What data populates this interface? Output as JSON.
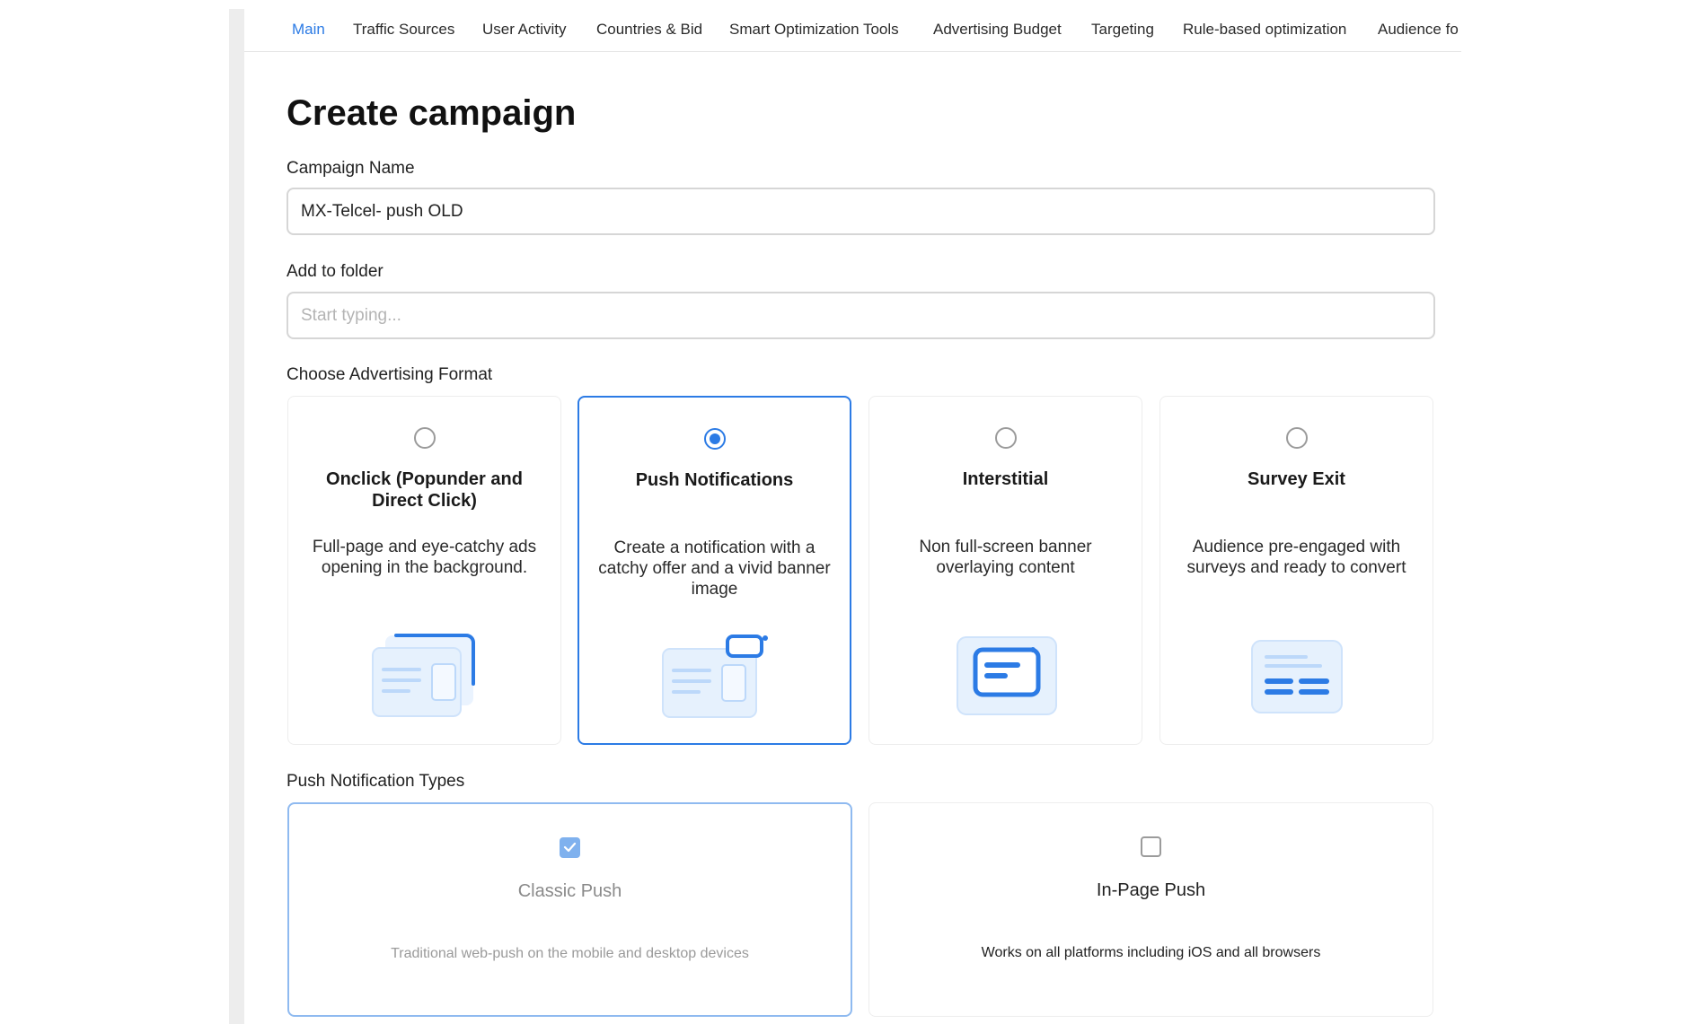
{
  "tabs": [
    {
      "label": "Main",
      "active": true
    },
    {
      "label": "Traffic Sources"
    },
    {
      "label": "User Activity"
    },
    {
      "label": "Countries & Bid"
    },
    {
      "label": "Smart Optimization Tools"
    },
    {
      "label": "Advertising Budget"
    },
    {
      "label": "Targeting"
    },
    {
      "label": "Rule-based optimization"
    },
    {
      "label": "Audience fo"
    }
  ],
  "page_title": "Create campaign",
  "campaign_name": {
    "label": "Campaign Name",
    "value": "MX-Telcel- push OLD"
  },
  "folder": {
    "label": "Add to folder",
    "placeholder": "Start typing..."
  },
  "ad_format": {
    "label": "Choose Advertising Format",
    "options": [
      {
        "title": "Onclick (Popunder and Direct Click)",
        "description": "Full-page and eye-catchy ads opening in the background.",
        "selected": false,
        "icon": "popunder-window-icon"
      },
      {
        "title": "Push Notifications",
        "description": "Create a notification with a catchy offer and a vivid banner image",
        "selected": true,
        "icon": "push-notification-icon"
      },
      {
        "title": "Interstitial",
        "description": "Non full-screen banner overlaying content",
        "selected": false,
        "icon": "interstitial-banner-icon"
      },
      {
        "title": "Survey Exit",
        "description": "Audience pre-engaged with surveys and ready to convert",
        "selected": false,
        "icon": "survey-form-icon"
      }
    ]
  },
  "push_types": {
    "label": "Push Notification Types",
    "options": [
      {
        "title": "Classic Push",
        "description": "Traditional web-push on the mobile and desktop devices",
        "checked": true
      },
      {
        "title": "In-Page Push",
        "description": "Works on all platforms including iOS and all browsers",
        "checked": false
      }
    ]
  },
  "colors": {
    "accent": "#2c7be5",
    "illustration_light": "#e6f1fd",
    "illustration_mid": "#b8d6fa"
  }
}
